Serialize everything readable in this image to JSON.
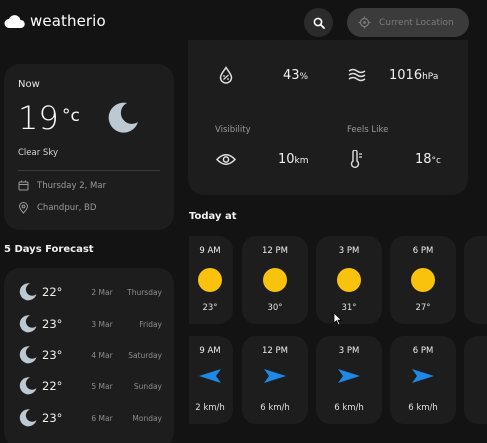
{
  "header": {
    "logo_text": "weatherio",
    "search_icon": "search-icon",
    "location_button_label": "Current Location"
  },
  "now": {
    "title": "Now",
    "temperature": "19",
    "unit": "°c",
    "condition": "Clear Sky",
    "date": "Thursday 2, Mar",
    "location": "Chandpur, BD",
    "icon": "moon-icon"
  },
  "highlights": {
    "humidity": {
      "value": "43",
      "unit": "%",
      "icon": "humidity-icon"
    },
    "pressure": {
      "value": "1016",
      "unit": "hPa",
      "icon": "pressure-icon"
    },
    "visibility": {
      "label": "Visibility",
      "value": "10",
      "unit": "km",
      "icon": "eye-icon"
    },
    "feels_like": {
      "label": "Feels Like",
      "value": "18",
      "unit": "°c",
      "icon": "thermometer-icon"
    }
  },
  "forecast": {
    "title": "5 Days Forecast",
    "items": [
      {
        "temp": "22°",
        "date": "2 Mar",
        "day": "Thursday"
      },
      {
        "temp": "23°",
        "date": "3 Mar",
        "day": "Friday"
      },
      {
        "temp": "23°",
        "date": "4 Mar",
        "day": "Saturday"
      },
      {
        "temp": "22°",
        "date": "5 Mar",
        "day": "Sunday"
      },
      {
        "temp": "23°",
        "date": "6 Mar",
        "day": "Monday"
      }
    ]
  },
  "today": {
    "title": "Today at",
    "temps": [
      {
        "time": "9 AM",
        "value": "23°"
      },
      {
        "time": "12 PM",
        "value": "30°"
      },
      {
        "time": "3 PM",
        "value": "31°"
      },
      {
        "time": "6 PM",
        "value": "27°"
      }
    ],
    "winds": [
      {
        "time": "9 AM",
        "value": "2 km/h"
      },
      {
        "time": "12 PM",
        "value": "6 km/h"
      },
      {
        "time": "3 PM",
        "value": "6 km/h"
      },
      {
        "time": "6 PM",
        "value": "6 km/h"
      }
    ]
  },
  "colors": {
    "background": "#131313",
    "card": "#1d1d1d",
    "sun": "#f9c20c",
    "wind_arrow": "#1e88e5"
  }
}
